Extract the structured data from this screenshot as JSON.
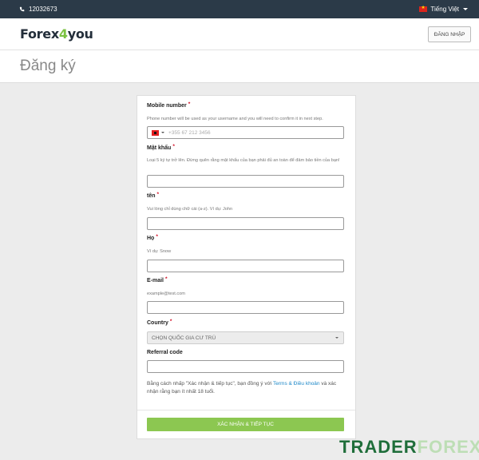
{
  "topbar": {
    "phone": "12032673",
    "language": "Tiếng Việt"
  },
  "header": {
    "logo_a": "Forex",
    "logo_b": "4",
    "logo_c": "you",
    "login": "ĐĂNG NHẬP"
  },
  "page": {
    "title": "Đăng ký"
  },
  "form": {
    "mobile": {
      "label": "Mobile number",
      "hint": "Phone number will be used as your username and you will need to confirm it in next step.",
      "placeholder": "+355 67 212 3456"
    },
    "password": {
      "label": "Mật khẩu",
      "hint": "Loại 5 ký tự trở lên. Đừng quên rằng mật khẩu của bạn phải đủ an toàn để đảm bảo tiền của bạn!"
    },
    "first_name": {
      "label": "tên",
      "hint": "Vui lòng chỉ dùng chữ cái (a-z). Ví dụ: John"
    },
    "last_name": {
      "label": "Họ",
      "hint": "Ví dụ: Snow"
    },
    "email": {
      "label": "E-mail",
      "hint": "example@test.com"
    },
    "country": {
      "label": "Country",
      "selected": "CHỌN QUỐC GIA CƯ TRÚ"
    },
    "referral": {
      "label": "Referral code"
    },
    "required_mark": "*",
    "terms_before": "Bằng cách nhấp \"Xác nhận & tiếp tục\", bạn đồng ý với ",
    "terms_link": "Terms & Điều khoản",
    "terms_after": " và xác nhận rằng bạn ít nhất 18 tuổi.",
    "submit": "XÁC NHẬN & TIẾP TỤC"
  },
  "watermark": {
    "part1": "TRADER",
    "part2": "FOREX"
  },
  "colors": {
    "topbar": "#2b3a48",
    "accent_green": "#8cc751",
    "link_blue": "#1e88c8",
    "required_red": "#d0021b"
  }
}
